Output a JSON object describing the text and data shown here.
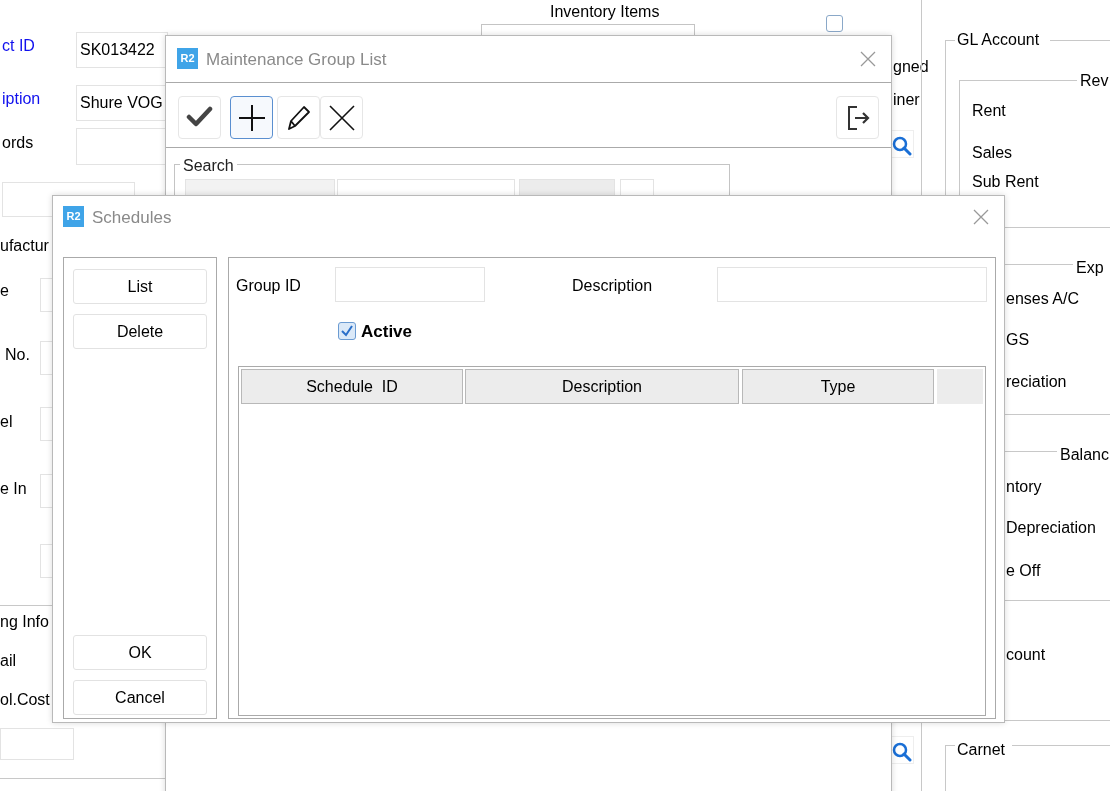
{
  "background_form": {
    "left_labels": [
      {
        "text": "ct ID",
        "highlighted": true
      },
      {
        "text": "iption",
        "highlighted": true
      },
      {
        "text": "ords",
        "highlighted": false
      },
      {
        "text": "ufactur",
        "highlighted": false
      },
      {
        "text": "e",
        "highlighted": false
      },
      {
        "text": "No.",
        "highlighted": false
      },
      {
        "text": "el",
        "highlighted": false
      },
      {
        "text": "e In",
        "highlighted": false
      },
      {
        "text": "ng Info",
        "highlighted": false
      },
      {
        "text": "ail",
        "highlighted": false
      },
      {
        "text": "ol.Cost",
        "highlighted": false
      }
    ],
    "fields": [
      {
        "value": "SK013422"
      },
      {
        "value": "Shure VOG"
      }
    ],
    "section_title": "Inventory Items",
    "checkbox": {
      "checked": false
    },
    "right_labels": [
      "gned",
      "iner"
    ],
    "gl_account": {
      "legend": "GL Account",
      "groups": [
        {
          "legend": "Rev",
          "items": [
            "Rent",
            "Sales",
            "Sub Rent"
          ]
        },
        {
          "legend": "Exp",
          "items": [
            "enses A/C",
            "GS",
            "reciation"
          ]
        },
        {
          "legend": "Balanc",
          "items": [
            "ntory",
            "Depreciation",
            "e Off"
          ]
        },
        {
          "items": [
            "count"
          ]
        }
      ]
    },
    "carnet": {
      "legend": "Carnet"
    }
  },
  "maintenance_window": {
    "logo_text": "R2",
    "title": "Maintenance Group List",
    "toolbar": [
      {
        "kind": "check",
        "selected": false
      },
      {
        "kind": "add",
        "selected": true
      },
      {
        "kind": "edit",
        "selected": false
      },
      {
        "kind": "delete",
        "selected": false
      },
      {
        "kind": "exit",
        "selected": false
      }
    ],
    "search": {
      "legend": "Search"
    }
  },
  "schedules_window": {
    "logo_text": "R2",
    "title": "Schedules",
    "top_buttons": [
      "List",
      "Delete"
    ],
    "bottom_buttons": [
      "OK",
      "Cancel"
    ],
    "group_id_label": "Group ID",
    "description_label": "Description",
    "active": {
      "label": "Active",
      "checked": true
    },
    "table": {
      "columns": [
        "Schedule  ID",
        "Description",
        "Type"
      ]
    }
  }
}
